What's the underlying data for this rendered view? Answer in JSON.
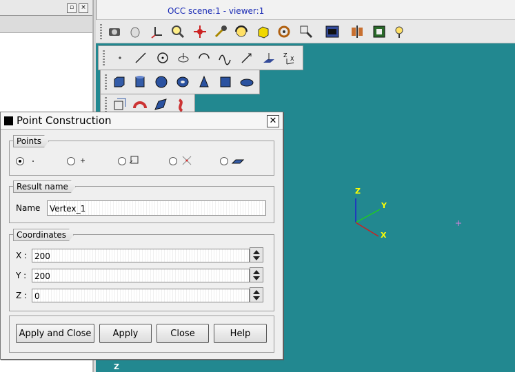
{
  "viewer": {
    "title": "OCC scene:1 - viewer:1"
  },
  "dialog": {
    "title": "Point Construction",
    "points_group": {
      "label": "Points",
      "options": [
        "point-by-coordinates",
        "point-by-reference",
        "point-on-edge",
        "point-intersection",
        "point-on-face"
      ],
      "selected": 0
    },
    "result_group": {
      "label": "Result name",
      "name_label": "Name",
      "name_value": "Vertex_1"
    },
    "coords_group": {
      "label": "Coordinates",
      "x_label": "X :",
      "x_value": "200",
      "y_label": "Y :",
      "y_value": "200",
      "z_label": "Z :",
      "z_value": "0"
    },
    "buttons": {
      "apply_close": "Apply and Close",
      "apply": "Apply",
      "close": "Close",
      "help": "Help"
    }
  },
  "triedron": {
    "x": "X",
    "y": "Y",
    "z": "Z",
    "z_corner": "Z"
  },
  "colors": {
    "viewport_bg": "#228890",
    "axis_x": "#cc2020",
    "axis_y": "#20cc20",
    "axis_z": "#2020cc",
    "label": "#ffff00"
  }
}
